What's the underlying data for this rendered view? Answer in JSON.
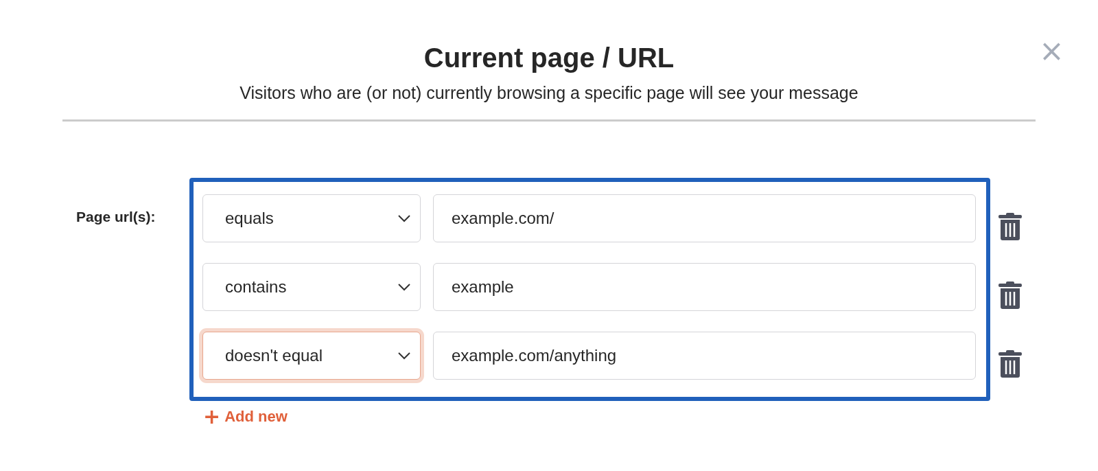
{
  "dialog": {
    "title": "Current page / URL",
    "subtitle": "Visitors who are (or not) currently browsing a specific page will see your message",
    "close": "×"
  },
  "form": {
    "label": "Page url(s):",
    "conditions": [
      {
        "operator": "equals",
        "value": "example.com/",
        "focused": false
      },
      {
        "operator": "contains",
        "value": "example",
        "focused": false
      },
      {
        "operator": "doesn't equal",
        "value": "example.com/anything",
        "focused": true
      }
    ],
    "add_button": {
      "icon": "+",
      "label": "Add new"
    }
  }
}
